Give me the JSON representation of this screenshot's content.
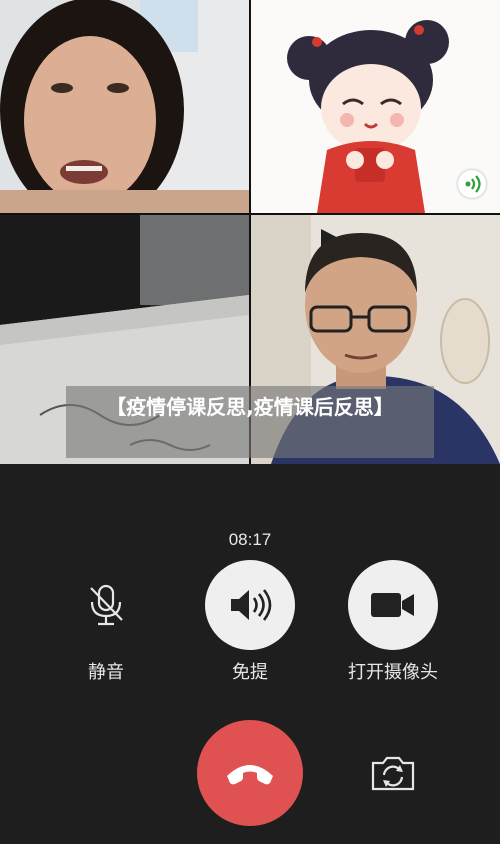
{
  "video_tiles": [
    {
      "role": "participant-woman"
    },
    {
      "role": "participant-cartoon-avatar"
    },
    {
      "role": "participant-paper-view"
    },
    {
      "role": "participant-man"
    }
  ],
  "banner": {
    "title": "【疫情停课反思,疫情课后反思】"
  },
  "call": {
    "timer": "08:17"
  },
  "controls": {
    "mute_label": "静音",
    "speaker_label": "免提",
    "camera_label": "打开摄像头"
  },
  "icons": {
    "mute": "mic-off-icon",
    "speaker": "speaker-icon",
    "camera": "video-camera-icon",
    "hangup": "phone-hangup-icon",
    "flip": "camera-switch-icon",
    "signal": "signal-icon"
  },
  "colors": {
    "background": "#1e1e1e",
    "hangup": "#e05252",
    "control_bg": "#efefef"
  }
}
